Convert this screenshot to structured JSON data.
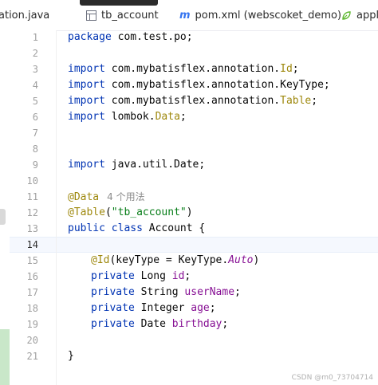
{
  "tabs": [
    {
      "label": "ation.java"
    },
    {
      "label": "tb_account",
      "icon": "table-icon"
    },
    {
      "label": "pom.xml (webscoket_demo)",
      "icon": "maven-m-icon"
    },
    {
      "label": "appli",
      "icon": "spring-leaf-icon"
    }
  ],
  "editor": {
    "current_line": 14,
    "line_numbers": [
      "1",
      "2",
      "3",
      "4",
      "5",
      "6",
      "7",
      "8",
      "9",
      "10",
      "11",
      "12",
      "13",
      "14",
      "15",
      "16",
      "17",
      "18",
      "19",
      "20",
      "21"
    ],
    "code": {
      "l1_kw": "package",
      "l1_rest": " com.test.po;",
      "l3_kw": "import",
      "l3_pkg": " com.mybatisflex.annotation.",
      "l3_cls": "Id",
      "l4_kw": "import",
      "l4_pkg": " com.mybatisflex.annotation.KeyType;",
      "l5_kw": "import",
      "l5_pkg": " com.mybatisflex.annotation.",
      "l5_cls": "Table",
      "l6_kw": "import",
      "l6_pkg": " lombok.",
      "l6_cls": "Data",
      "l9_kw": "import",
      "l9_pkg": " java.util.Date;",
      "l11_ann": "@Data",
      "l11_hint": "4 个用法",
      "l12_ann": "@Table",
      "l12_str": "\"tb_account\"",
      "l13_kw1": "public",
      "l13_kw2": "class",
      "l13_name": " Account {",
      "l15_ann": "@Id",
      "l15_mid": "(keyType = KeyType.",
      "l15_enum": "Auto",
      "l16_kw": "private",
      "l16_type": " Long ",
      "l16_fld": "id",
      "l17_kw": "private",
      "l17_type": " String ",
      "l17_fld": "userName",
      "l18_kw": "private",
      "l18_type": " Integer ",
      "l18_fld": "age",
      "l19_kw": "private",
      "l19_type": " Date ",
      "l19_fld": "birthday",
      "l21_brace": "}"
    }
  },
  "watermark": "CSDN @m0_73704714",
  "colors": {
    "keyword": "#0033b3",
    "annotation": "#9e880d",
    "field": "#871094",
    "string": "#067d17",
    "line_number": "#a0a0a0",
    "current_line_bg": "#f5f8fe",
    "vcs_added": "#c9e7c9"
  }
}
